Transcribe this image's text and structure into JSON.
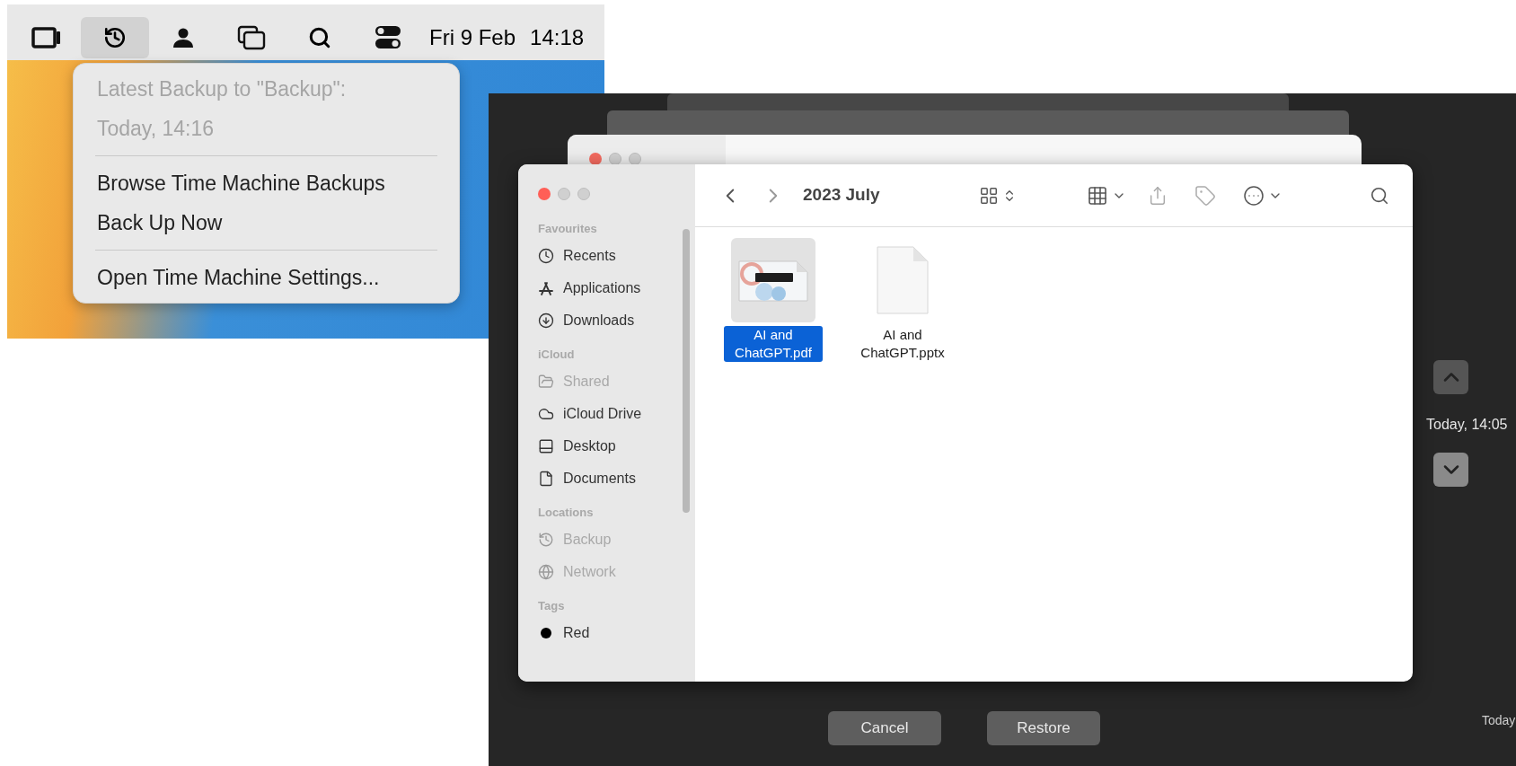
{
  "menu_bar": {
    "icons": [
      {
        "kind": "display",
        "selected": false
      },
      {
        "kind": "time_machine",
        "selected": true
      },
      {
        "kind": "user",
        "selected": false
      },
      {
        "kind": "windows",
        "selected": false
      },
      {
        "kind": "search",
        "selected": false
      },
      {
        "kind": "controls",
        "selected": false
      }
    ],
    "date": "Fri 9 Feb",
    "time": "14:18"
  },
  "menu": {
    "items": [
      {
        "kind": "info",
        "label": "Latest Backup to \"Backup\":",
        "disabled": true
      },
      {
        "kind": "info",
        "label": "Today, 14:16",
        "disabled": true
      },
      {
        "kind": "separator"
      },
      {
        "kind": "action",
        "label": "Browse Time Machine Backups",
        "disabled": false
      },
      {
        "kind": "action",
        "label": "Back Up Now",
        "disabled": false
      },
      {
        "kind": "separator"
      },
      {
        "kind": "action",
        "label": "Open Time Machine Settings...",
        "disabled": false
      }
    ]
  },
  "finder": {
    "title": "2023 July",
    "sidebar": [
      {
        "heading": "Favourites",
        "items": [
          {
            "label": "Recents",
            "kind": "clock",
            "disabled": false
          },
          {
            "label": "Applications",
            "kind": "apps",
            "disabled": false
          },
          {
            "label": "Downloads",
            "kind": "download",
            "disabled": false
          }
        ]
      },
      {
        "heading": "iCloud",
        "items": [
          {
            "label": "Shared",
            "kind": "shared",
            "disabled": true
          },
          {
            "label": "iCloud Drive",
            "kind": "cloud",
            "disabled": false
          },
          {
            "label": "Desktop",
            "kind": "desktop",
            "disabled": false
          },
          {
            "label": "Documents",
            "kind": "document",
            "disabled": false
          }
        ]
      },
      {
        "heading": "Locations",
        "items": [
          {
            "label": "Backup",
            "kind": "history",
            "disabled": true
          },
          {
            "label": "Network",
            "kind": "globe",
            "disabled": true
          }
        ]
      },
      {
        "heading": "Tags",
        "items": [
          {
            "label": "Red",
            "kind": "tag",
            "color": "#000000",
            "disabled": false
          }
        ]
      }
    ],
    "files": [
      {
        "name": "AI and ChatGPT.pdf",
        "kind": "pdf",
        "selected": true
      },
      {
        "name": "AI and ChatGPT.pptx",
        "kind": "pptx",
        "selected": false
      }
    ]
  },
  "timeline": {
    "current": "Today, 14:05",
    "bottom": "Today"
  },
  "buttons": [
    "Cancel",
    "Restore"
  ]
}
